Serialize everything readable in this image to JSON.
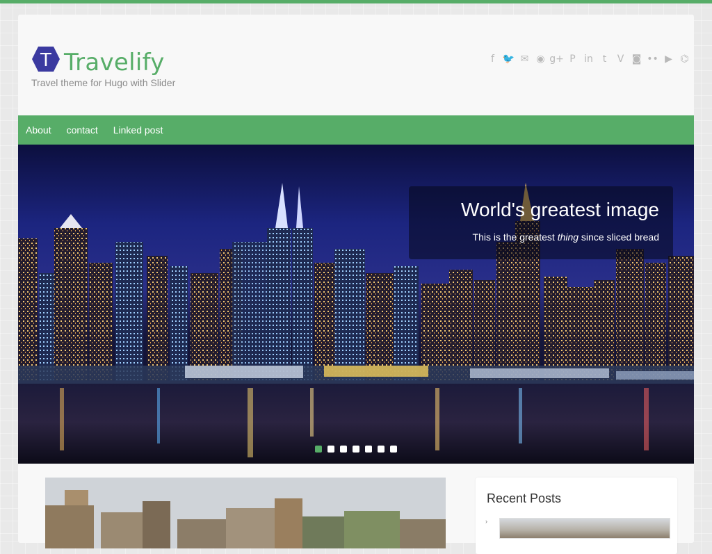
{
  "site": {
    "title": "Travelify",
    "tagline": "Travel theme for Hugo with Slider",
    "logo_letter": "T",
    "accent_color": "#57ad68",
    "logo_color": "#3b3aa0"
  },
  "social_icons": [
    {
      "name": "facebook-icon",
      "glyph": "f"
    },
    {
      "name": "twitter-icon",
      "glyph": "🐦"
    },
    {
      "name": "email-icon",
      "glyph": "✉"
    },
    {
      "name": "rss-icon",
      "glyph": "◉"
    },
    {
      "name": "google-plus-icon",
      "glyph": "g+"
    },
    {
      "name": "pinterest-icon",
      "glyph": "P"
    },
    {
      "name": "linkedin-icon",
      "glyph": "in"
    },
    {
      "name": "tumblr-icon",
      "glyph": "t"
    },
    {
      "name": "vimeo-icon",
      "glyph": "V"
    },
    {
      "name": "instagram-icon",
      "glyph": "◙"
    },
    {
      "name": "flickr-icon",
      "glyph": "••"
    },
    {
      "name": "youtube-icon",
      "glyph": "▶"
    },
    {
      "name": "github-icon",
      "glyph": "⌬"
    }
  ],
  "nav": {
    "items": [
      "About",
      "contact",
      "Linked post"
    ]
  },
  "slider": {
    "caption_title": "World's greatest image",
    "caption_before": "This is the greatest ",
    "caption_em": "thing",
    "caption_after": " since sliced bread",
    "slide_count": 7,
    "active_index": 0
  },
  "sidebar": {
    "widget_title": "Recent Posts",
    "recent_bullet": "›"
  }
}
